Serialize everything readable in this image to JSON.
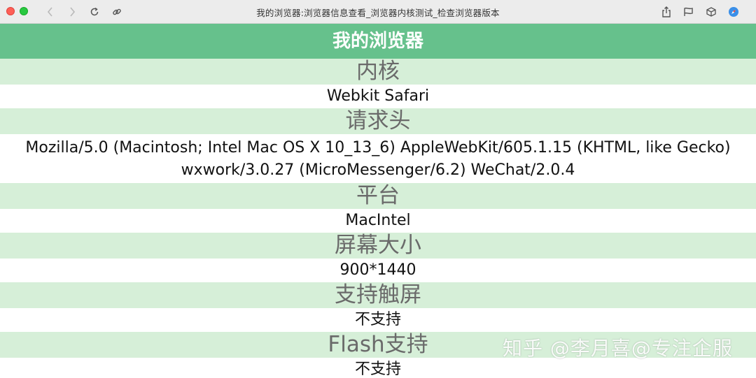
{
  "window": {
    "title": "我的浏览器:浏览器信息查看_浏览器内核测试_检查浏览器版本"
  },
  "toolbar": {
    "back_icon": "chevron-left-icon",
    "forward_icon": "chevron-right-icon",
    "reload_icon": "reload-icon",
    "link_icon": "link-icon",
    "share_icon": "share-icon",
    "flag_icon": "flag-icon",
    "box_icon": "box-icon",
    "safari_icon": "safari-icon"
  },
  "page": {
    "heading": "我的浏览器",
    "kernel_label": "内核",
    "kernel_value": "Webkit Safari",
    "ua_label": "请求头",
    "ua_line1": "Mozilla/5.0 (Macintosh; Intel Mac OS X 10_13_6) AppleWebKit/605.1.15 (KHTML, like Gecko)",
    "ua_line2": "wxwork/3.0.27 (MicroMessenger/6.2) WeChat/2.0.4",
    "platform_label": "平台",
    "platform_value": "MacIntel",
    "screen_label": "屏幕大小",
    "screen_value": "900*1440",
    "touch_label": "支持触屏",
    "touch_value": "不支持",
    "flash_label": "Flash支持",
    "flash_value": "不支持"
  },
  "watermark": "知乎 @李月喜@专注企服",
  "colors": {
    "header_green": "#66c18c",
    "section_green": "#d6efd8"
  }
}
